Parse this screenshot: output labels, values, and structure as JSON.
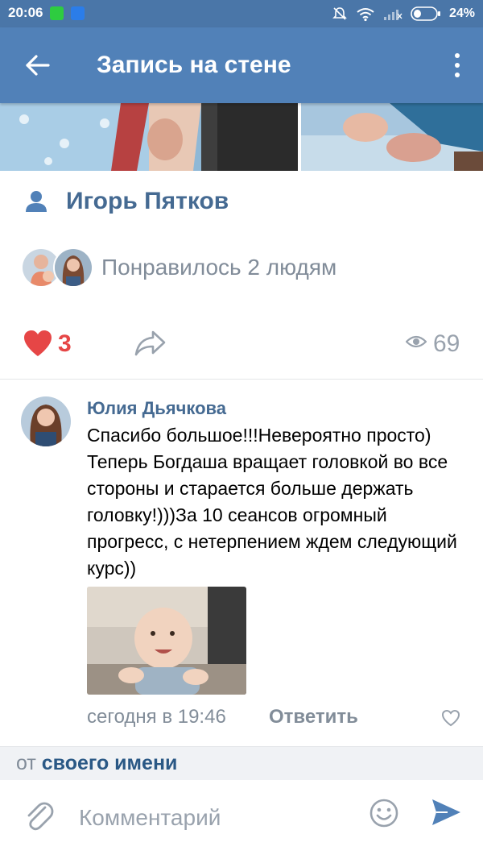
{
  "status_bar": {
    "time": "20:06",
    "battery": "24%"
  },
  "header": {
    "title": "Запись на стене"
  },
  "post": {
    "author": "Игорь Пятков",
    "likes_text": "Понравилось 2 людям",
    "like_count": "3",
    "views": "69"
  },
  "comment": {
    "author": "Юлия Дьячкова",
    "text": "Спасибо большое!!!Невероятно просто) Теперь Богдаша вращает головкой во все стороны и старается больше держать головку!)))За 10 сеансов огромный прогресс, с нетерпением ждем  следующий курс))",
    "time": "сегодня в 19:46",
    "reply_label": "Ответить"
  },
  "compose": {
    "from_label": "от",
    "from_name": "своего имени",
    "placeholder": "Комментарий"
  },
  "colors": {
    "header_bg": "#5181b8",
    "status_bg": "#4a76a8",
    "link": "#456a92",
    "like_red": "#e64646",
    "send_blue": "#5181b8"
  },
  "icons": [
    "back-arrow-icon",
    "more-vertical-icon",
    "person-icon",
    "heart-icon",
    "share-icon",
    "eye-icon",
    "heart-outline-icon",
    "paperclip-icon",
    "smile-icon",
    "send-icon",
    "wifi-icon",
    "bell-off-icon",
    "signal-icon",
    "battery-icon"
  ]
}
